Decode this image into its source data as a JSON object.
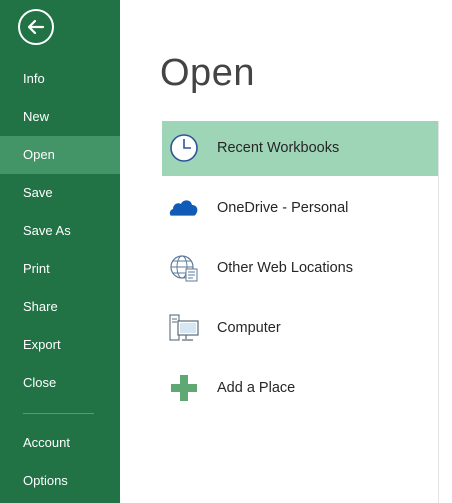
{
  "sidebar": {
    "items": [
      {
        "label": "Info"
      },
      {
        "label": "New"
      },
      {
        "label": "Open"
      },
      {
        "label": "Save"
      },
      {
        "label": "Save As"
      },
      {
        "label": "Print"
      },
      {
        "label": "Share"
      },
      {
        "label": "Export"
      },
      {
        "label": "Close"
      },
      {
        "label": "Account"
      },
      {
        "label": "Options"
      }
    ],
    "active_item": "Open"
  },
  "main": {
    "title": "Open",
    "places": [
      {
        "label": "Recent Workbooks",
        "icon": "clock-icon",
        "selected": true
      },
      {
        "label": "OneDrive - Personal",
        "icon": "cloud-icon"
      },
      {
        "label": "Other Web Locations",
        "icon": "globe-icon"
      },
      {
        "label": "Computer",
        "icon": "computer-icon"
      },
      {
        "label": "Add a Place",
        "icon": "plus-icon"
      }
    ]
  },
  "colors": {
    "sidebar_bg": "#217346",
    "sidebar_active": "#439467",
    "selected_place_bg": "#9fd5b7"
  }
}
